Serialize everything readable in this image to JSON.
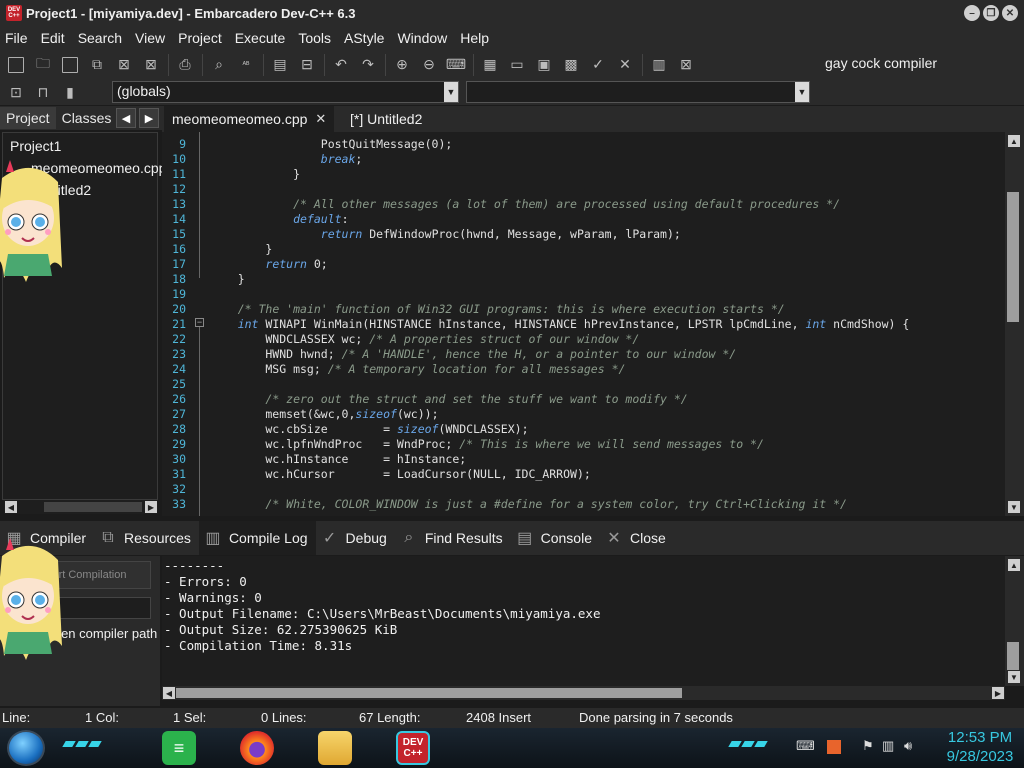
{
  "window": {
    "title": "Project1 - [miyamiya.dev] - Embarcadero Dev-C++ 6.3",
    "app_icon_label": "DEV C++",
    "controls": [
      "minimize",
      "restore",
      "close"
    ]
  },
  "menu": [
    "File",
    "Edit",
    "Search",
    "View",
    "Project",
    "Execute",
    "Tools",
    "AStyle",
    "Window",
    "Help"
  ],
  "toolbar": {
    "compiler_set": "gay cock compiler",
    "scope_select": "(globals)",
    "member_select": ""
  },
  "left_panel": {
    "tabs": [
      "Project",
      "Classes"
    ],
    "tree": [
      "Project1",
      "meomeomeomeo.cpp",
      "Untitled2"
    ],
    "tree_visible": [
      "Project1",
      "meomeomeomeo.cpp",
      "ntitled2"
    ]
  },
  "editor": {
    "tabs": [
      {
        "label": "meomeomeomeo.cpp",
        "active": true
      },
      {
        "label": "[*] Untitled2",
        "active": false
      }
    ],
    "lines": [
      {
        "n": "9",
        "code": "                PostQuitMessage(0);"
      },
      {
        "n": "10",
        "code": "                break;"
      },
      {
        "n": "11",
        "code": "            }"
      },
      {
        "n": "12",
        "code": ""
      },
      {
        "n": "13",
        "code": "            /* All other messages (a lot of them) are processed using default procedures */"
      },
      {
        "n": "14",
        "code": "            default:"
      },
      {
        "n": "15",
        "code": "                return DefWindowProc(hwnd, Message, wParam, lParam);"
      },
      {
        "n": "16",
        "code": "        }"
      },
      {
        "n": "17",
        "code": "        return 0;"
      },
      {
        "n": "18",
        "code": "    }"
      },
      {
        "n": "19",
        "code": ""
      },
      {
        "n": "20",
        "code": "    /* The 'main' function of Win32 GUI programs: this is where execution starts */"
      },
      {
        "n": "21",
        "code": "    int WINAPI WinMain(HINSTANCE hInstance, HINSTANCE hPrevInstance, LPSTR lpCmdLine, int nCmdShow) {"
      },
      {
        "n": "22",
        "code": "        WNDCLASSEX wc; /* A properties struct of our window */"
      },
      {
        "n": "23",
        "code": "        HWND hwnd; /* A 'HANDLE', hence the H, or a pointer to our window */"
      },
      {
        "n": "24",
        "code": "        MSG msg; /* A temporary location for all messages */"
      },
      {
        "n": "25",
        "code": ""
      },
      {
        "n": "26",
        "code": "        /* zero out the struct and set the stuff we want to modify */"
      },
      {
        "n": "27",
        "code": "        memset(&wc,0,sizeof(wc));"
      },
      {
        "n": "28",
        "code": "        wc.cbSize        = sizeof(WNDCLASSEX);"
      },
      {
        "n": "29",
        "code": "        wc.lpfnWndProc   = WndProc; /* This is where we will send messages to */"
      },
      {
        "n": "30",
        "code": "        wc.hInstance     = hInstance;"
      },
      {
        "n": "31",
        "code": "        wc.hCursor       = LoadCursor(NULL, IDC_ARROW);"
      },
      {
        "n": "32",
        "code": ""
      },
      {
        "n": "33",
        "code": "        /* White, COLOR_WINDOW is just a #define for a system color, try Ctrl+Clicking it */"
      }
    ]
  },
  "bottom_panel": {
    "tabs": [
      "Compiler",
      "Resources",
      "Compile Log",
      "Debug",
      "Find Results",
      "Console",
      "Close"
    ],
    "active_tab": "Compile Log",
    "abort_label": "Abort Compilation",
    "compiler_path_label": "Shorten compiler path",
    "log": [
      "--------",
      "- Errors: 0",
      "- Warnings: 0",
      "- Output Filename: C:\\Users\\MrBeast\\Documents\\miyamiya.exe",
      "- Output Size: 62.275390625 KiB",
      "- Compilation Time: 8.31s"
    ]
  },
  "status": {
    "line": "Line:",
    "col": "1 Col:",
    "sel": "1 Sel:",
    "lines": "0 Lines:",
    "length": "67 Length:",
    "insert": "2408 Insert",
    "message": "Done parsing in 7 seconds"
  },
  "taskbar": {
    "apps": [
      "notes",
      "firefox",
      "file-explorer",
      "dev-cpp"
    ],
    "devcpp_label": "DEV C++",
    "time": "12:53 PM",
    "date": "9/28/2023"
  },
  "colors": {
    "background": "#1b1b1b",
    "panel": "#2a2a2a",
    "editor_bg": "#1e1e1e",
    "line_numbers": "#4fb6d8",
    "keyword": "#6aa6e8",
    "comment": "#8a9a8a",
    "clock": "#37c8e0"
  }
}
